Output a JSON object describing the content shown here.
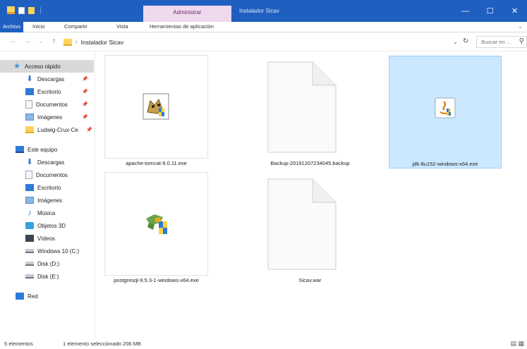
{
  "window": {
    "context_tab": "Administrar",
    "title": "Instalador Sicav",
    "controls": [
      "—",
      "☐",
      "✕"
    ]
  },
  "ribbon": {
    "tabs": [
      "Archivo",
      "Inicio",
      "Compartir",
      "Vista",
      "Herramientas de aplicación"
    ]
  },
  "address": {
    "path": "Instalador Sicav",
    "search_placeholder": "Buscar en ..."
  },
  "nav": {
    "items": [
      {
        "label": "Acceso rápido",
        "icon": "star-icon",
        "pinned": false
      },
      {
        "label": "Descargas",
        "icon": "download-icon",
        "pinned": true
      },
      {
        "label": "Escritorio",
        "icon": "desktop-icon",
        "pinned": true
      },
      {
        "label": "Documentos",
        "icon": "documents-icon",
        "pinned": true
      },
      {
        "label": "Imágenes",
        "icon": "pictures-icon",
        "pinned": true
      },
      {
        "label": "Ludwig-Crux-Ce",
        "icon": "folder-icon",
        "pinned": true
      },
      {
        "label": "Este equipo",
        "icon": "computer-icon",
        "pinned": false
      },
      {
        "label": "Descargas",
        "icon": "download-icon",
        "pinned": false
      },
      {
        "label": "Documentos",
        "icon": "documents-icon",
        "pinned": false
      },
      {
        "label": "Escritorio",
        "icon": "desktop-icon",
        "pinned": false
      },
      {
        "label": "Imágenes",
        "icon": "pictures-icon",
        "pinned": false
      },
      {
        "label": "Música",
        "icon": "music-icon",
        "pinned": false
      },
      {
        "label": "Objetos 3D",
        "icon": "objects-3d-icon",
        "pinned": false
      },
      {
        "label": "Vídeos",
        "icon": "videos-icon",
        "pinned": false
      },
      {
        "label": "Windows 10 (C:)",
        "icon": "drive-icon",
        "pinned": false
      },
      {
        "label": "Disk (D:)",
        "icon": "drive-icon",
        "pinned": false
      },
      {
        "label": "Disk (E:)",
        "icon": "drive-icon",
        "pinned": false
      },
      {
        "label": "Red",
        "icon": "network-icon",
        "pinned": false
      }
    ]
  },
  "files": [
    {
      "name": "apache-tomcat-9.0.11.exe",
      "icon": "tomcat-installer-icon",
      "selected": false
    },
    {
      "name": "Backup-20191207234045.backup",
      "icon": "generic-file-icon",
      "selected": false
    },
    {
      "name": "jdk-8u152-windows-x64.exe",
      "icon": "java-installer-icon",
      "selected": true
    },
    {
      "name": "postgresql-9.5.3-1-windows-x64.exe",
      "icon": "postgresql-installer-icon",
      "selected": false
    },
    {
      "name": "Sicav.war",
      "icon": "generic-file-icon",
      "selected": false
    }
  ],
  "status": {
    "count": "5 elementos",
    "selection": "1 elemento seleccionado  206 MB"
  }
}
